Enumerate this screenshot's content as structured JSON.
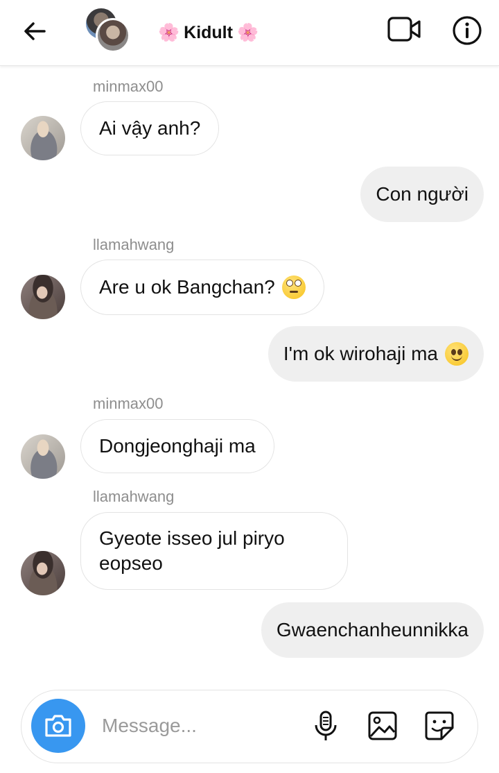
{
  "header": {
    "title": "Kidult",
    "title_emoji": "🌸",
    "icons": [
      "arrow-left-icon",
      "video-call-icon",
      "info-icon"
    ]
  },
  "messages": [
    {
      "type": "incoming",
      "sender": "minmax00",
      "text": "Ai vậy anh?"
    },
    {
      "type": "outgoing",
      "text": "Con người"
    },
    {
      "type": "incoming",
      "sender": "llamahwang",
      "text": "Are u ok Bangchan?",
      "emoji": "eye-roll"
    },
    {
      "type": "outgoing",
      "text": "I'm ok wirohaji ma",
      "emoji": "slight-smile"
    },
    {
      "type": "incoming",
      "sender": "minmax00",
      "text": "Dongjeonghaji ma"
    },
    {
      "type": "incoming",
      "sender": "llamahwang",
      "text_line1": "Gyeote isseo jul piryo",
      "text_line2": "eopseo"
    },
    {
      "type": "outgoing",
      "text": "Gwaenchanheunnikka"
    }
  ],
  "composer": {
    "placeholder": "Message...",
    "camera_color": "#3897f0",
    "icons": [
      "camera-icon",
      "microphone-icon",
      "gallery-icon",
      "sticker-icon"
    ]
  }
}
